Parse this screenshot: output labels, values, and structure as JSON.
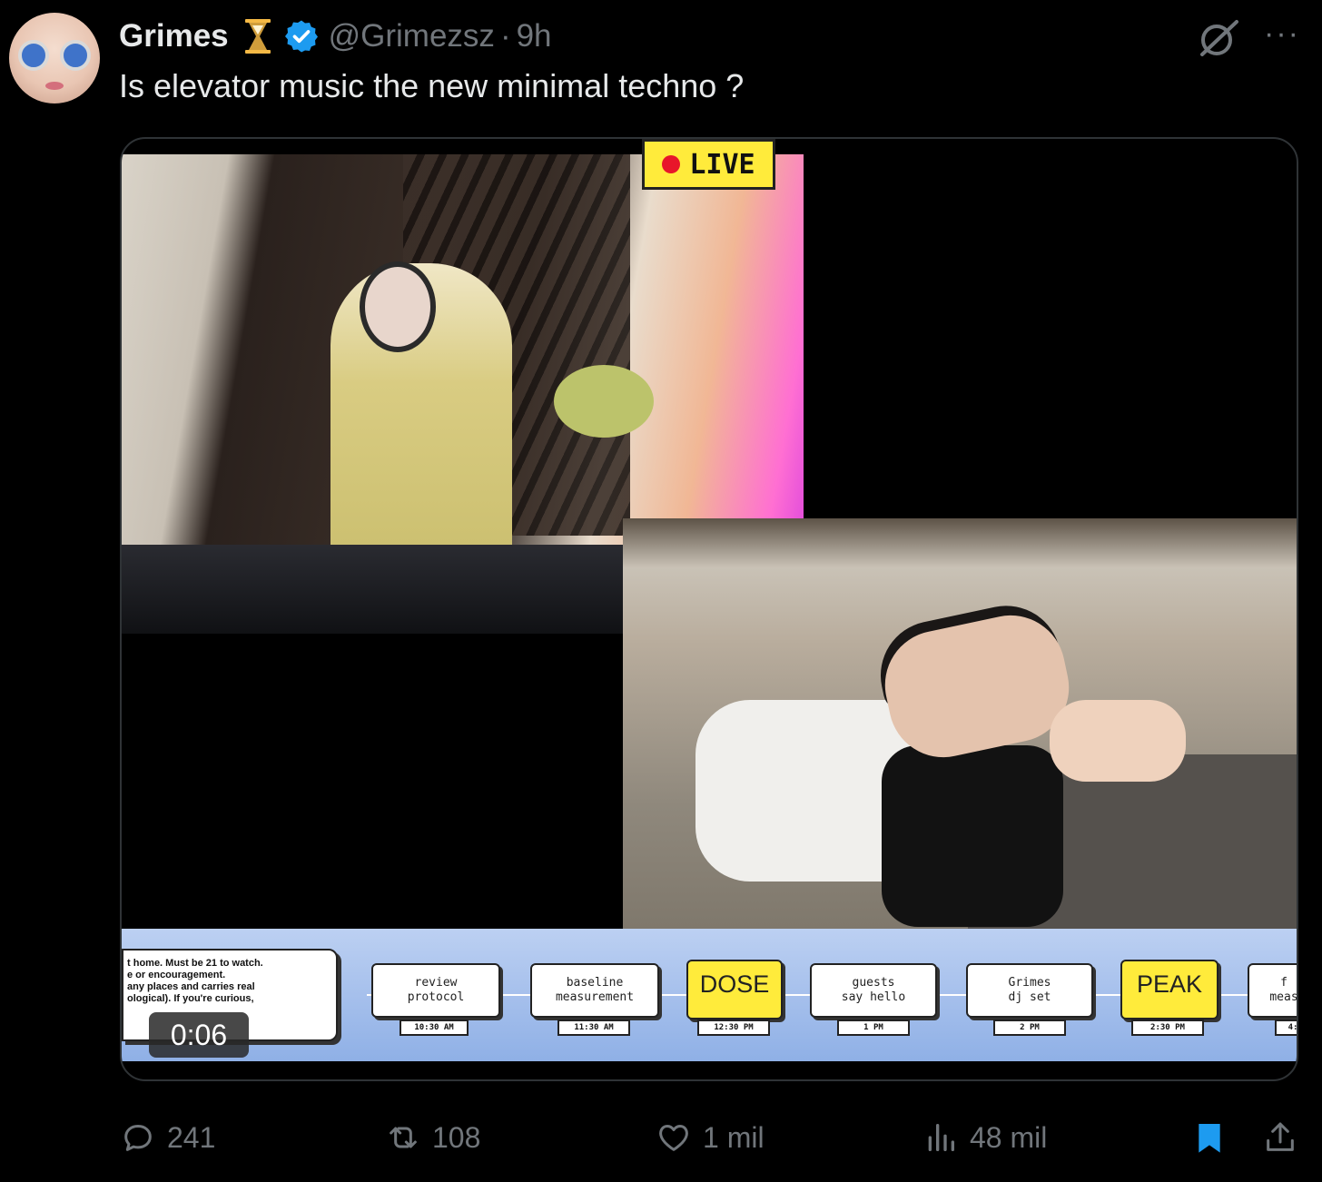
{
  "tweet": {
    "author_name": "Grimes",
    "handle": "@Grimezsz",
    "separator": "·",
    "time": "9h",
    "text": "Is elevator music the new minimal techno ?",
    "verified": true,
    "colors": {
      "verified": "#1d9bf0",
      "hourglass": "#f5b945",
      "muted": "#71767b",
      "bookmark": "#1d9bf0"
    }
  },
  "video": {
    "live_label": "LIVE",
    "timestamp": "0:06",
    "note_lines": [
      "t home. Must be 21 to watch.",
      "e or encouragement.",
      "any places and carries real",
      "ological). If you're curious,"
    ],
    "schedule": [
      {
        "label_lines": [
          "review",
          "protocol"
        ],
        "time": "10:30 AM",
        "highlight": false
      },
      {
        "label_lines": [
          "baseline",
          "measurement"
        ],
        "time": "11:30 AM",
        "highlight": false
      },
      {
        "label_lines": [
          "DOSE"
        ],
        "time": "12:30 PM",
        "highlight": true
      },
      {
        "label_lines": [
          "guests",
          "say hello"
        ],
        "time": "1 PM",
        "highlight": false
      },
      {
        "label_lines": [
          "Grimes",
          "dj set"
        ],
        "time": "2 PM",
        "highlight": false
      },
      {
        "label_lines": [
          "PEAK"
        ],
        "time": "2:30 PM",
        "highlight": true
      },
      {
        "label_lines": [
          "f",
          "meas"
        ],
        "time": "4:",
        "highlight": false
      }
    ]
  },
  "actions": {
    "replies": "241",
    "reposts": "108",
    "likes": "1 mil",
    "views": "48 mil"
  },
  "icons": [
    "hourglass-icon",
    "verified-badge-icon",
    "grok-icon",
    "more-icon",
    "reply-icon",
    "repost-icon",
    "like-icon",
    "views-icon",
    "bookmark-icon",
    "share-icon"
  ]
}
